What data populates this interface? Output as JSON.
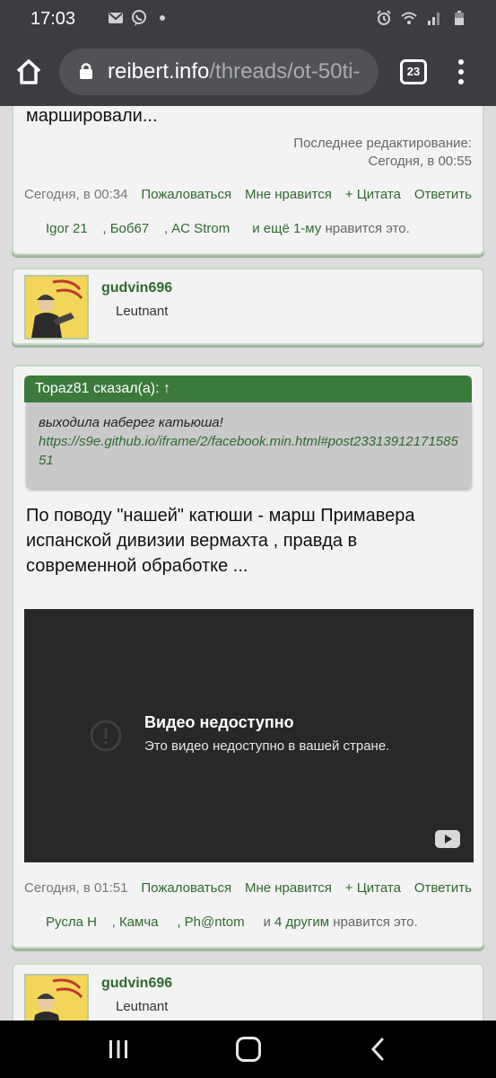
{
  "status_bar": {
    "time": "17:03",
    "left_icons": [
      "gmail-icon",
      "viber-icon",
      "dot-icon"
    ],
    "right_icons": [
      "alarm-icon",
      "wifi-icon",
      "signal-icon",
      "battery-icon"
    ]
  },
  "browser": {
    "url_host": "reibert.info",
    "url_path": "/threads/ot-50ti-",
    "tab_count": "23"
  },
  "post1": {
    "text_tail": "маршировали...",
    "edited_label": "Последнее редактирование:",
    "edited_time": "Сегодня, в 00:55",
    "date": "Сегодня, в 00:34",
    "actions": [
      "Пожаловаться",
      "Мне нравится",
      "+ Цитата",
      "Ответить"
    ],
    "likes": {
      "users": [
        "Igor 21",
        ", Боб67",
        ", AC Strom"
      ],
      "more": "и ещё 1-му",
      "suffix": " нравится это."
    }
  },
  "user1": {
    "username": "gudvin696",
    "title": "Leutnant"
  },
  "post2": {
    "quote_author": "Topaz81 сказал(а): ↑",
    "quote_text": "выходила наберег катьюша!",
    "quote_link": "https://s9e.github.io/iframe/2/facebook.min.html#post2331391217158551",
    "text": "По поводу \"нашей\" катюши - марш Примавера испанской дивизии вермахта , правда в современной обработке ...",
    "video": {
      "title": "Видео недоступно",
      "subtitle": "Это видео недоступно в вашей стране."
    },
    "date": "Сегодня, в 01:51",
    "actions": [
      "Пожаловаться",
      "Мне нравится",
      "+ Цитата",
      "Ответить"
    ],
    "likes": {
      "users": [
        "Русла Н",
        ", Камча",
        ", Ph@ntom"
      ],
      "more": "и 4 другим",
      "suffix": " нравится это."
    }
  },
  "user2": {
    "username": "gudvin696",
    "title": "Leutnant"
  },
  "colors": {
    "accent_green": "#2e6b2e",
    "quote_header": "#3c7a3c",
    "chrome_bar": "#3b3d40"
  }
}
